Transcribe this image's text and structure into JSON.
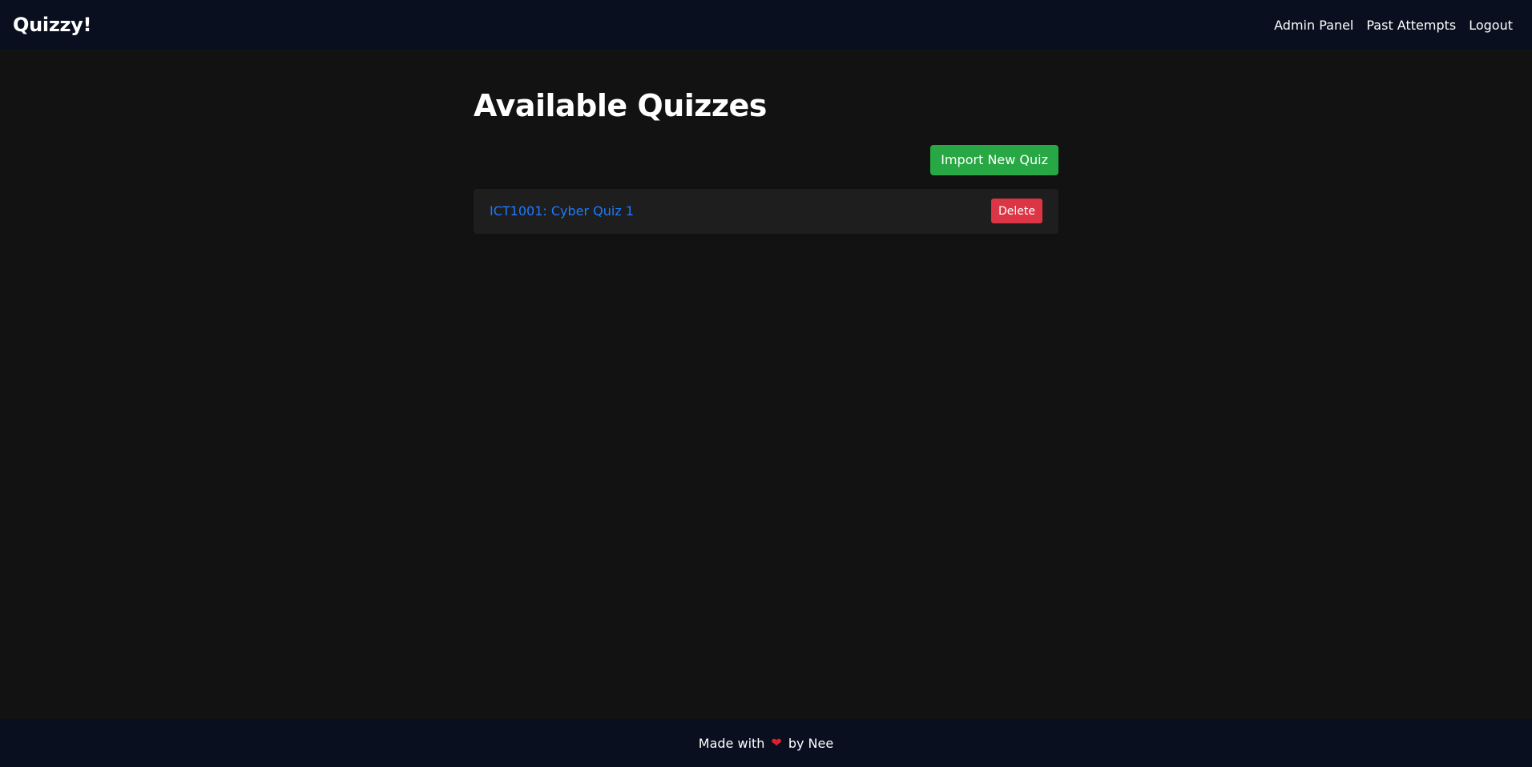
{
  "navbar": {
    "brand": "Quizzy!",
    "links": [
      {
        "label": "Admin Panel"
      },
      {
        "label": "Past Attempts"
      },
      {
        "label": "Logout"
      }
    ]
  },
  "main": {
    "title": "Available Quizzes",
    "import_button_label": "Import New Quiz",
    "quizzes": [
      {
        "title": "ICT1001: Cyber Quiz 1",
        "delete_label": "Delete"
      }
    ]
  },
  "footer": {
    "prefix": "Made with",
    "heart_icon": "heart-icon",
    "suffix": "by Nee"
  },
  "colors": {
    "background": "#121212",
    "navbar": "#0a0f20",
    "success": "#28a745",
    "danger": "#dc3545",
    "link": "#1e7aff"
  }
}
